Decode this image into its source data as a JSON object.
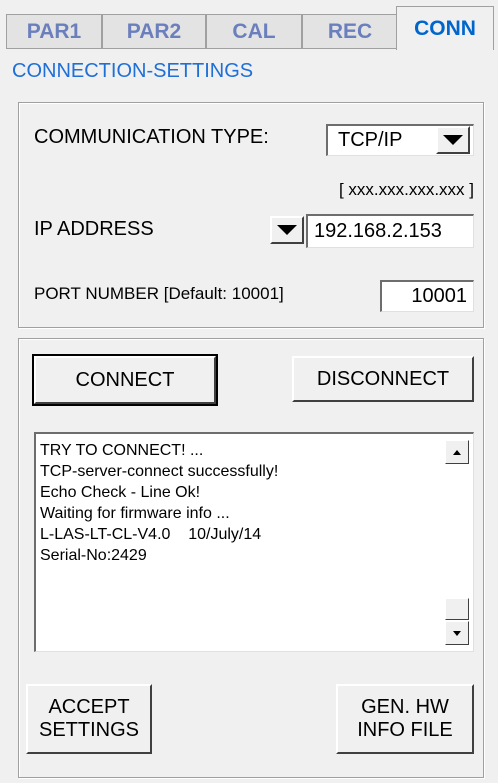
{
  "tabs": [
    {
      "label": "PAR1",
      "active": false
    },
    {
      "label": "PAR2",
      "active": false
    },
    {
      "label": "CAL",
      "active": false
    },
    {
      "label": "REC",
      "active": false
    },
    {
      "label": "CONN",
      "active": true
    }
  ],
  "section_title": "CONNECTION-SETTINGS",
  "settings": {
    "communication_type_label": "COMMUNICATION TYPE:",
    "communication_type_value": "TCP/IP",
    "ip_format_hint": "[ xxx.xxx.xxx.xxx ]",
    "ip_address_label": "IP ADDRESS",
    "ip_address_value": "192.168.2.153",
    "port_label": "PORT NUMBER [Default: 10001]",
    "port_value": "10001"
  },
  "buttons": {
    "connect": "CONNECT",
    "disconnect": "DISCONNECT",
    "accept_line1": "ACCEPT",
    "accept_line2": "SETTINGS",
    "genhw_line1": "GEN. HW",
    "genhw_line2": "INFO FILE"
  },
  "log": {
    "lines": [
      "TRY TO CONNECT! ...",
      "TCP-server-connect successfully!",
      "Echo Check - Line Ok!",
      "Waiting for firmware info ...",
      "L-LAS-LT-CL-V4.0    10/July/14",
      "Serial-No:2429"
    ]
  },
  "icons": {
    "dropdown": "chevron-down-icon",
    "scroll_up": "arrow-up-icon",
    "scroll_down": "arrow-down-icon"
  }
}
